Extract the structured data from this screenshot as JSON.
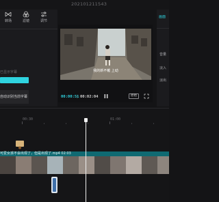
{
  "app": {
    "window_title": "202101211543"
  },
  "left_panel": {
    "tools": [
      {
        "label": "转场",
        "icon": "transition-icon"
      },
      {
        "label": "滤镜",
        "icon": "filter-icon"
      },
      {
        "label": "调节",
        "icon": "adjust-icon"
      }
    ],
    "text_a": "已显示字幕",
    "option_text": "自动识别当前字幕"
  },
  "player": {
    "subtitle": "我的新不戴 上动",
    "time_current": "00:00:51",
    "time_separator": "|",
    "time_total": "00:02:04",
    "ratio_label": "原始"
  },
  "right_panel": {
    "tab_label": "画面",
    "labels": [
      "音量",
      "淡入",
      "淡出"
    ]
  },
  "timeline": {
    "ruler_labels": [
      "00:30",
      "01:00"
    ],
    "clip_title": "可爱女孩不会出现了，但是出现了.mp4  02:03"
  },
  "colors": {
    "accent": "#2fd3df",
    "clip_header": "#0f6a72"
  }
}
